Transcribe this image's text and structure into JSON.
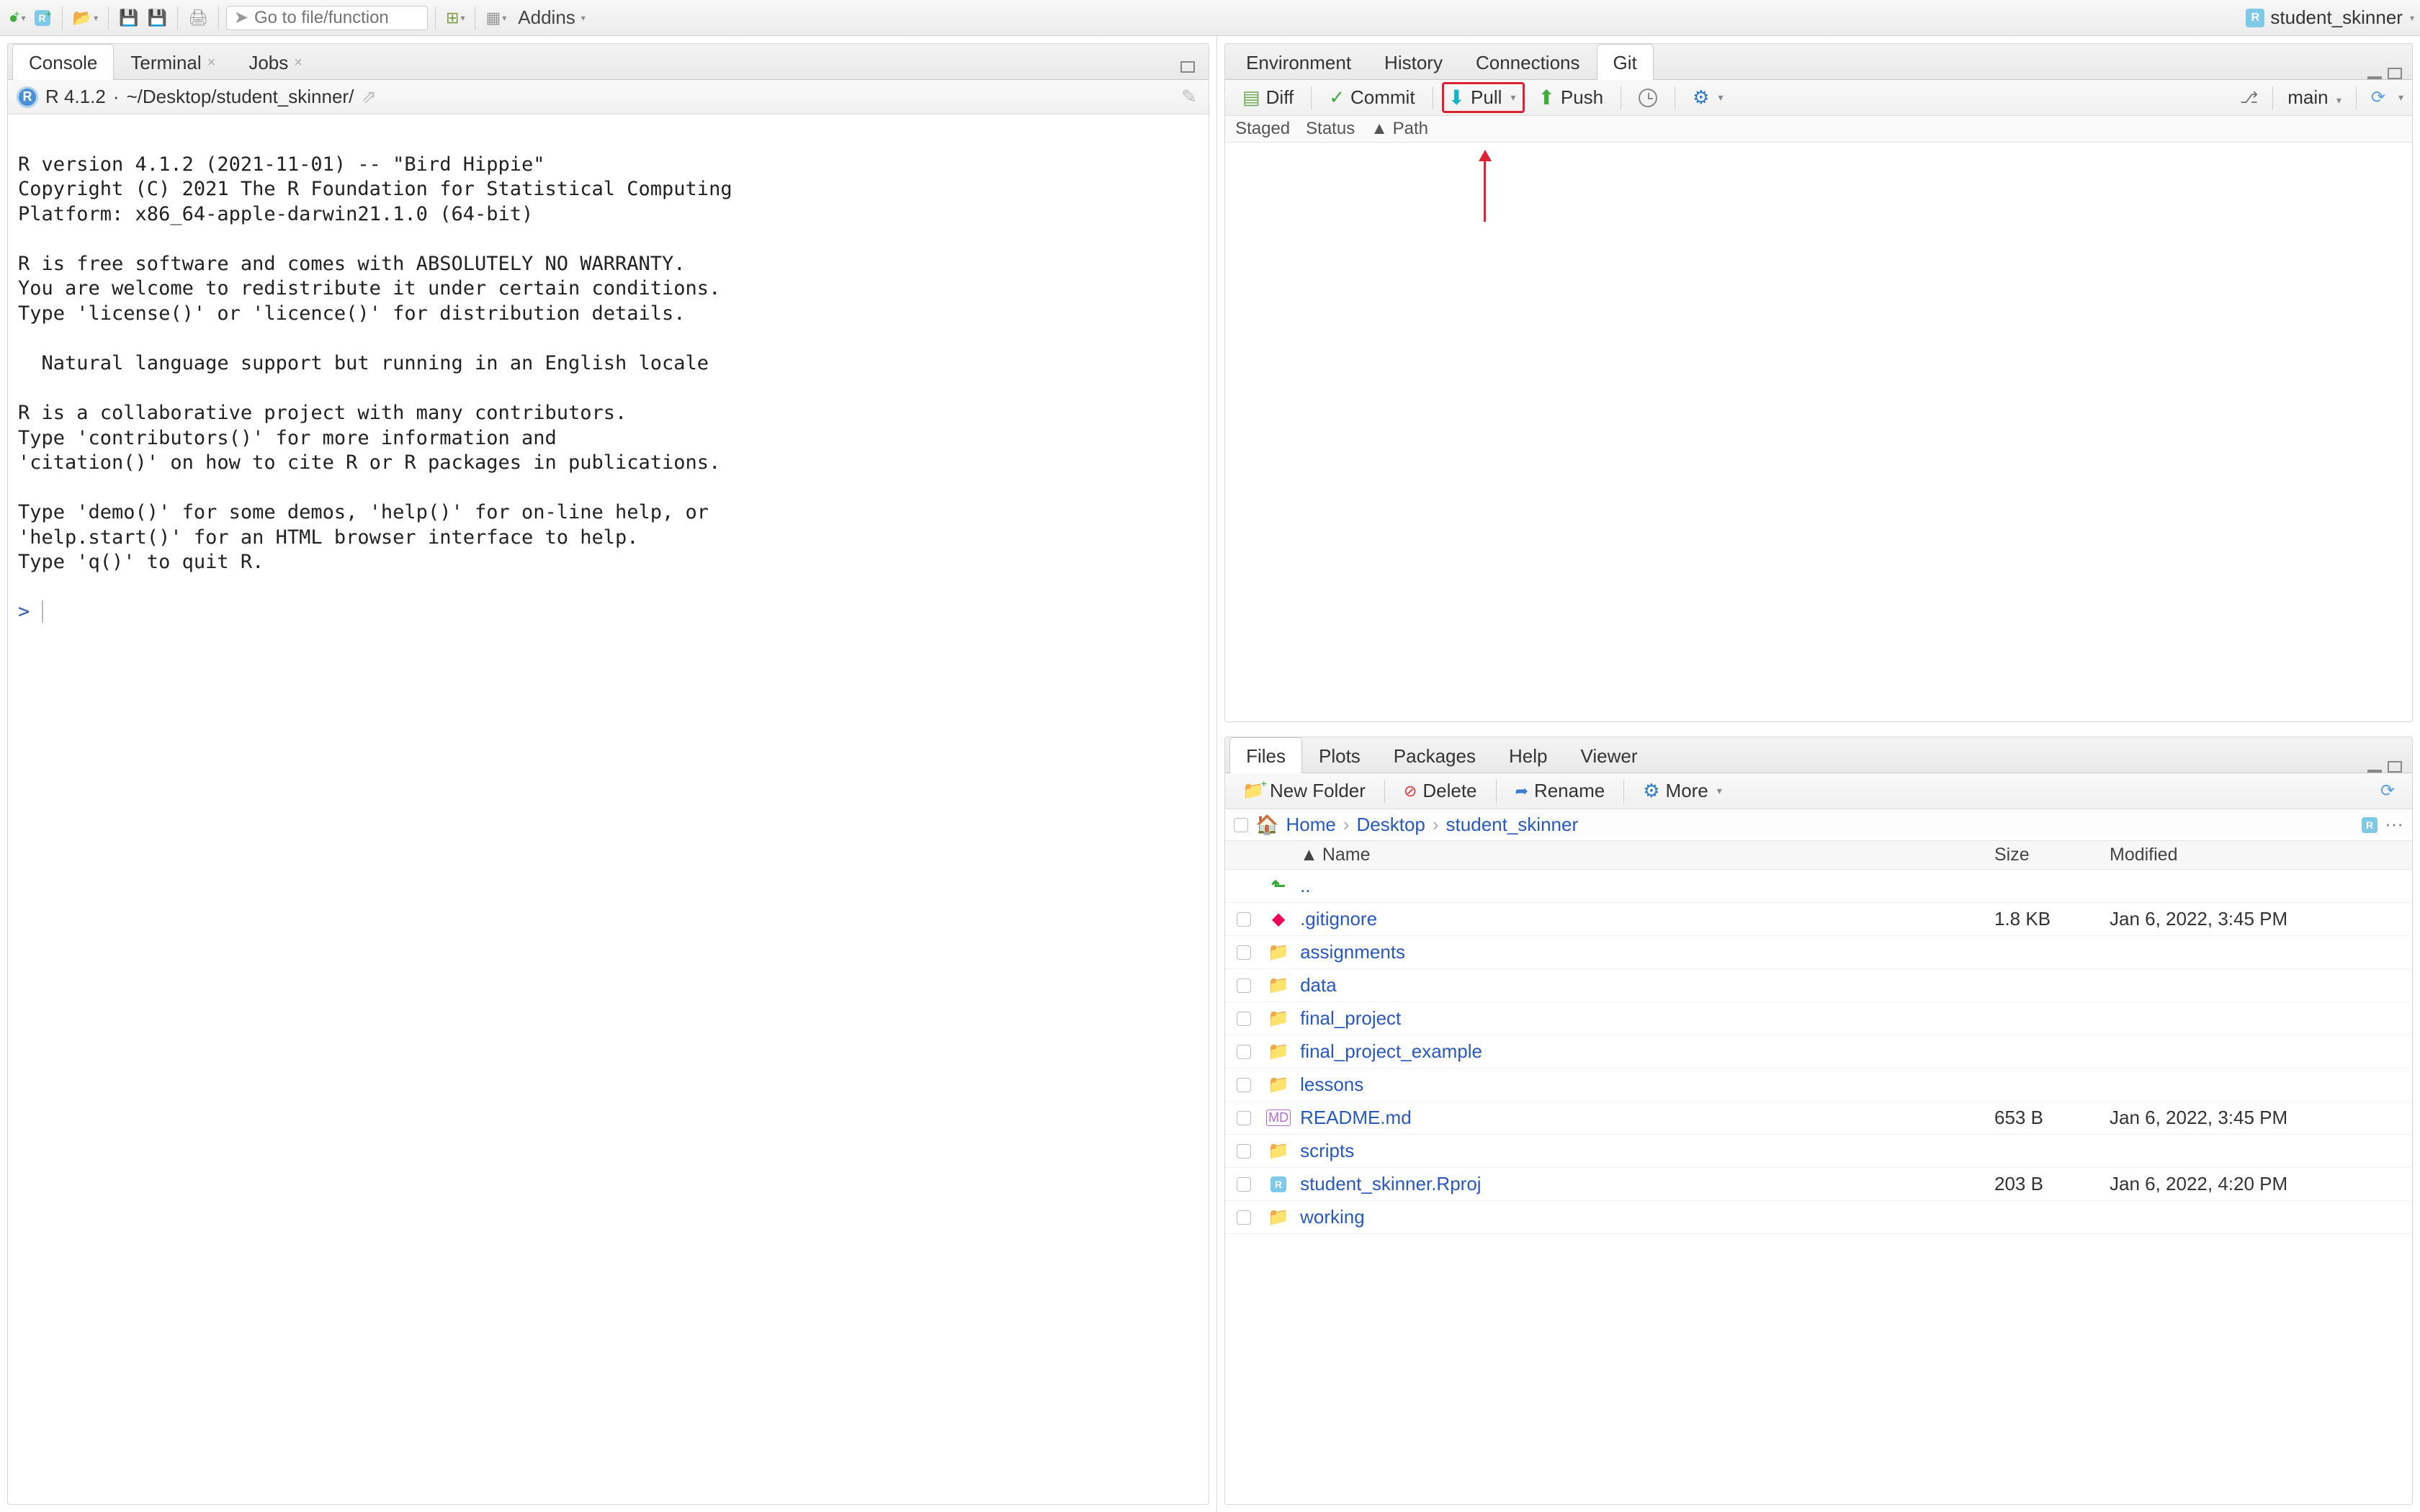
{
  "toolbar": {
    "search_placeholder": "Go to file/function",
    "addins_label": "Addins",
    "project_name": "student_skinner"
  },
  "left_pane": {
    "tabs": [
      "Console",
      "Terminal",
      "Jobs"
    ],
    "active_tab": 0,
    "r_version": "R 4.1.2",
    "wd": "~/Desktop/student_skinner/",
    "console_text": "\nR version 4.1.2 (2021-11-01) -- \"Bird Hippie\"\nCopyright (C) 2021 The R Foundation for Statistical Computing\nPlatform: x86_64-apple-darwin21.1.0 (64-bit)\n\nR is free software and comes with ABSOLUTELY NO WARRANTY.\nYou are welcome to redistribute it under certain conditions.\nType 'license()' or 'licence()' for distribution details.\n\n  Natural language support but running in an English locale\n\nR is a collaborative project with many contributors.\nType 'contributors()' for more information and\n'citation()' on how to cite R or R packages in publications.\n\nType 'demo()' for some demos, 'help()' for on-line help, or\n'help.start()' for an HTML browser interface to help.\nType 'q()' to quit R.\n\n",
    "prompt": "> "
  },
  "right_top": {
    "tabs": [
      "Environment",
      "History",
      "Connections",
      "Git"
    ],
    "active_tab": 3,
    "diff_label": "Diff",
    "commit_label": "Commit",
    "pull_label": "Pull",
    "push_label": "Push",
    "branch_name": "main",
    "headers": {
      "staged": "Staged",
      "status": "Status",
      "path": "Path"
    }
  },
  "right_bottom": {
    "tabs": [
      "Files",
      "Plots",
      "Packages",
      "Help",
      "Viewer"
    ],
    "active_tab": 0,
    "new_folder": "New Folder",
    "delete": "Delete",
    "rename": "Rename",
    "more": "More",
    "breadcrumb": [
      "Home",
      "Desktop",
      "student_skinner"
    ],
    "cols": {
      "name": "Name",
      "size": "Size",
      "modified": "Modified"
    },
    "up_dir": "..",
    "rows": [
      {
        "icon": "git",
        "name": ".gitignore",
        "size": "1.8 KB",
        "modified": "Jan 6, 2022, 3:45 PM"
      },
      {
        "icon": "folder",
        "name": "assignments",
        "size": "",
        "modified": ""
      },
      {
        "icon": "folder",
        "name": "data",
        "size": "",
        "modified": ""
      },
      {
        "icon": "folder",
        "name": "final_project",
        "size": "",
        "modified": ""
      },
      {
        "icon": "folder",
        "name": "final_project_example",
        "size": "",
        "modified": ""
      },
      {
        "icon": "folder",
        "name": "lessons",
        "size": "",
        "modified": ""
      },
      {
        "icon": "md",
        "name": "README.md",
        "size": "653 B",
        "modified": "Jan 6, 2022, 3:45 PM"
      },
      {
        "icon": "folder",
        "name": "scripts",
        "size": "",
        "modified": ""
      },
      {
        "icon": "rproj",
        "name": "student_skinner.Rproj",
        "size": "203 B",
        "modified": "Jan 6, 2022, 4:20 PM"
      },
      {
        "icon": "folder",
        "name": "working",
        "size": "",
        "modified": ""
      }
    ]
  }
}
